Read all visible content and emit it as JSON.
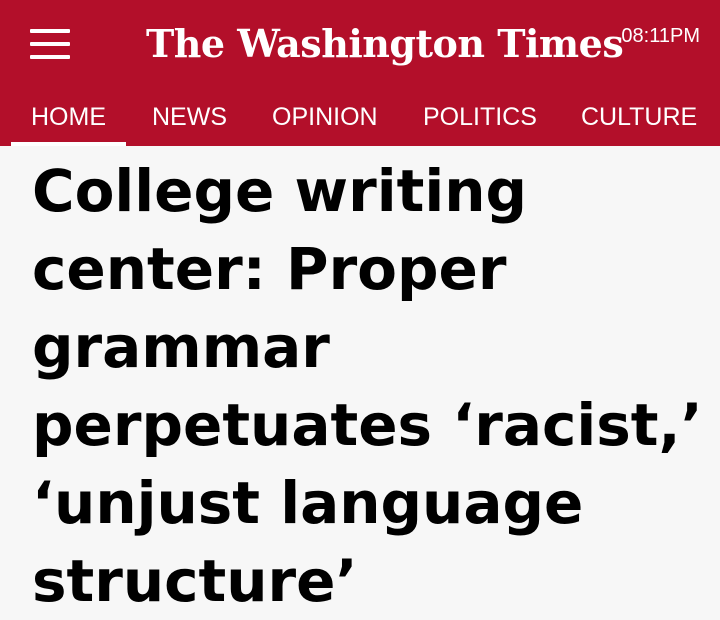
{
  "header": {
    "brand": "The Washington Times",
    "time": "08:11PM",
    "menu_icon": "hamburger-menu-icon",
    "bg_color": "#b30f2a"
  },
  "nav": {
    "tabs": [
      {
        "label": "HOME",
        "active": true
      },
      {
        "label": "NEWS",
        "active": false
      },
      {
        "label": "OPINION",
        "active": false
      },
      {
        "label": "POLITICS",
        "active": false
      },
      {
        "label": "CULTURE",
        "active": false
      }
    ]
  },
  "article": {
    "headline": "College writing center: Proper grammar perpetuates ‘racist,’ ‘unjust language structure’"
  }
}
